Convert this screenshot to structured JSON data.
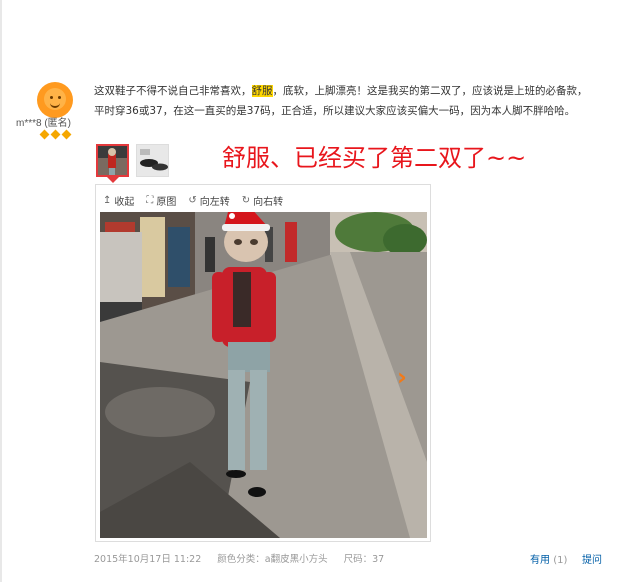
{
  "user": {
    "name": "m***8 (匿名)"
  },
  "review": {
    "text_before": "这双鞋子不得不说自己非常喜欢，",
    "highlight": "舒服",
    "text_after": "，底软，上脚漂亮！这是我买的第二双了，应该说是上班的必备款，平时穿36或37，在这一直买的是37码，正合适，所以建议大家应该买偏大一码，因为本人脚不胖哈哈。"
  },
  "annotation": "舒服、已经买了第二双了~~",
  "viewer": {
    "collapse_label": "收起",
    "original_label": "原图",
    "rotate_left_label": "向左转",
    "rotate_right_label": "向右转"
  },
  "footer": {
    "date": "2015年10月17日 11:22",
    "color_class": "颜色分类：a翻皮黑小方头",
    "size": "尺码：37",
    "useful_label": "有用",
    "useful_count": "(1)",
    "reply_label": "提问"
  },
  "colors": {
    "accent_red": "#e4393c",
    "annotation_red": "#e8161c",
    "highlight": "#ffd700",
    "link_blue": "#005ea7",
    "arrow_orange": "#f07a1a"
  }
}
